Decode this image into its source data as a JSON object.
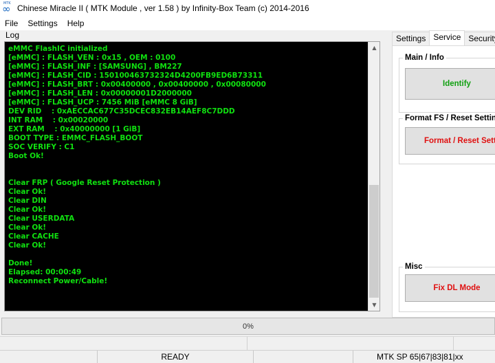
{
  "window": {
    "title": "Chinese Miracle II ( MTK Module , ver 1.58 ) by Infinity-Box Team (c) 2014-2016",
    "icon_top_text": "MTK",
    "icon": "infinity-icon"
  },
  "menu": {
    "items": [
      "File",
      "Settings",
      "Help"
    ]
  },
  "log": {
    "label": "Log",
    "text_color": "#10e010",
    "lines": [
      "eMMC FlashIC initialized",
      "[eMMC] : FLASH_VEN : 0x15 , OEM : 0100",
      "[eMMC] : FLASH_INF : [SAMSUNG] , BM227",
      "[eMMC] : FLASH_CID : 150100463732324D4200FB9ED6B73311",
      "[eMMC] : FLASH_BRT : 0x00400000 , 0x00400000 , 0x00080000",
      "[eMMC] : FLASH_LEN : 0x00000001D2000000",
      "[eMMC] : FLASH_UCP : 7456 MiB [eMMC 8 GiB]",
      "DEV RID    : 0xAECCAC677C35DCEC832EB14AEF8C7DDD",
      "INT RAM    : 0x00020000",
      "EXT RAM    : 0x40000000 [1 GiB]",
      "BOOT TYPE : EMMC_FLASH_BOOT",
      "SOC VERIFY : C1",
      "Boot Ok!",
      "",
      "",
      "Clear FRP ( Google Reset Protection )",
      "Clear Ok!",
      "Clear DIN",
      "Clear Ok!",
      "Clear USERDATA",
      "Clear Ok!",
      "Clear CACHE",
      "Clear Ok!",
      "",
      "Done!",
      "Elapsed: 00:00:49",
      "Reconnect Power/Cable!"
    ]
  },
  "tabs": [
    {
      "label": "Settings",
      "active": false
    },
    {
      "label": "Service",
      "active": true
    },
    {
      "label": "Security",
      "active": false
    }
  ],
  "service": {
    "main_info": {
      "title": "Main / Info",
      "button": "Identify",
      "button_color": "#10a010"
    },
    "format_fs": {
      "title": "Format FS / Reset Settings",
      "button": "Format / Reset Settings",
      "button_color": "#e01010"
    },
    "misc": {
      "title": "Misc",
      "button": "Fix DL Mode",
      "button_color": "#e01010"
    }
  },
  "progress": {
    "text": "0%",
    "value": 0
  },
  "status": {
    "state": "READY",
    "device_info": "MTK SP 65|67|83|81|xx"
  }
}
